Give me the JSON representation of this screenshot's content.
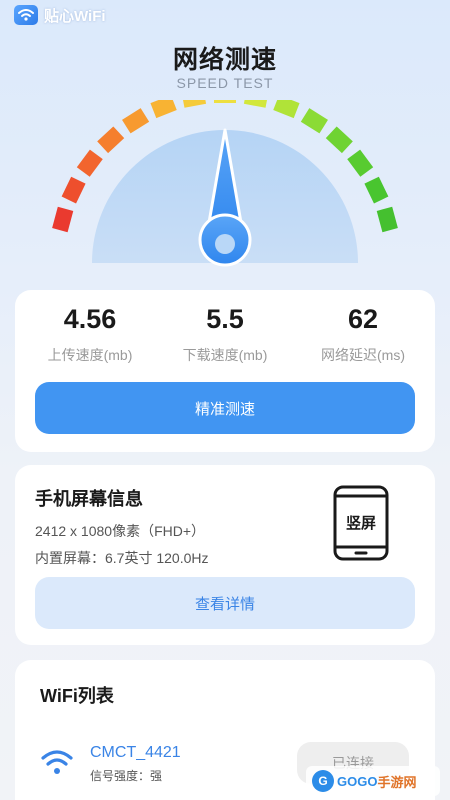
{
  "app": {
    "name": "贴心WiFi",
    "icon": "wifi-logo-icon"
  },
  "header": {
    "title": "网络测速",
    "subtitle": "SPEED TEST"
  },
  "gauge": {
    "level": 0.5,
    "segment_colors": [
      "#ea3a2f",
      "#ee4f2d",
      "#f2652e",
      "#f57f2e",
      "#f79a30",
      "#f8b333",
      "#f5cb3b",
      "#eddf40",
      "#d2e73c",
      "#b0e338",
      "#8bdb35",
      "#6fd332",
      "#58cb30",
      "#49c52f",
      "#45c02f"
    ]
  },
  "stats": [
    {
      "value": "4.56",
      "label": "上传速度(mb)"
    },
    {
      "value": "5.5",
      "label": "下载速度(mb)"
    },
    {
      "value": "62",
      "label": "网络延迟(ms)"
    }
  ],
  "speed_test": {
    "button_label": "精准测速"
  },
  "screen_info": {
    "title": "手机屏幕信息",
    "resolution": "2412 x 1080像素（FHD+）",
    "size": "内置屏幕：6.7英寸 120.0Hz",
    "orientation": "竖屏",
    "button_label": "查看详情"
  },
  "wifi_list": {
    "title": "WiFi列表",
    "items": [
      {
        "ssid": "CMCT_4421",
        "signal": "信号强度：强",
        "status": "已连接"
      }
    ]
  },
  "watermark": {
    "badge": "G",
    "text_a": "GOGO",
    "text_b": "手游网"
  },
  "colors": {
    "accent": "#4195f2",
    "accent_light": "#dbe9fb",
    "link": "#3a84e6"
  }
}
